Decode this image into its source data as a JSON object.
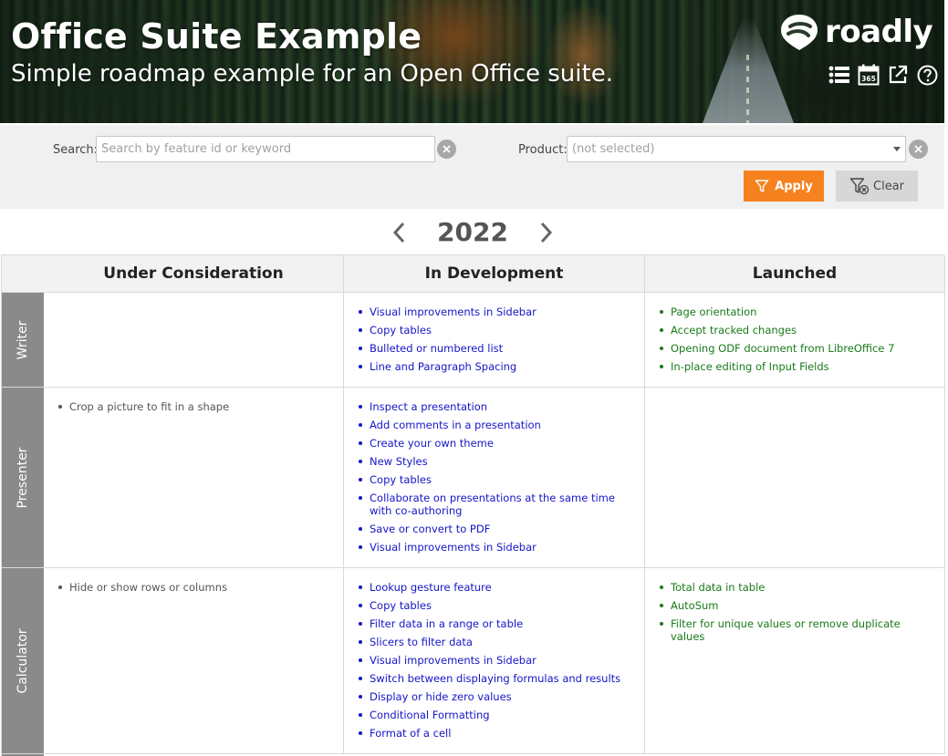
{
  "header": {
    "title": "Office Suite Example",
    "subtitle": "Simple roadmap example for an Open Office suite.",
    "logo_text": "roadly",
    "icons": [
      "list-icon",
      "calendar-365-icon",
      "external-link-icon",
      "help-icon"
    ],
    "calendar_badge": "365"
  },
  "filters": {
    "search_label": "Search:",
    "search_placeholder": "Search by feature id or keyword",
    "search_value": "",
    "product_label": "Product:",
    "product_value": "(not selected)",
    "apply_label": "Apply",
    "clear_label": "Clear",
    "apply_color": "#f5821f"
  },
  "year_nav": {
    "year": "2022"
  },
  "columns": [
    "Under Consideration",
    "In Development",
    "Launched"
  ],
  "rows": [
    {
      "label": "Writer",
      "under_consideration": [],
      "in_development": [
        "Visual improvements in Sidebar",
        "Copy tables",
        "Bulleted or numbered list",
        "Line and Paragraph Spacing"
      ],
      "launched": [
        "Page orientation",
        "Accept tracked changes",
        "Opening ODF document from LibreOffice 7",
        "In-place editing of Input Fields"
      ]
    },
    {
      "label": "Presenter",
      "under_consideration": [
        "Crop a picture to fit in a shape"
      ],
      "in_development": [
        "Inspect a presentation",
        "Add comments in a presentation",
        "Create your own theme",
        "New Styles",
        "Copy tables",
        "Collaborate on presentations at the same time with co-authoring",
        "Save or convert to PDF",
        "Visual improvements in Sidebar"
      ],
      "launched": []
    },
    {
      "label": "Calculator",
      "under_consideration": [
        "Hide or show rows or columns"
      ],
      "in_development": [
        "Lookup gesture feature",
        "Copy tables",
        "Filter data in a range or table",
        "Slicers to filter data",
        "Visual improvements in Sidebar",
        "Switch between displaying formulas and results",
        "Display or hide zero values",
        "Conditional Formatting",
        "Format of a cell"
      ],
      "launched": [
        "Total data in table",
        "AutoSum",
        "Filter for unique values or remove duplicate values"
      ]
    }
  ],
  "colors": {
    "in_development_text": "#1515c8",
    "launched_text": "#1a7a1a",
    "under_consideration_text": "#555555",
    "row_header_bg": "#8a8a8a"
  }
}
